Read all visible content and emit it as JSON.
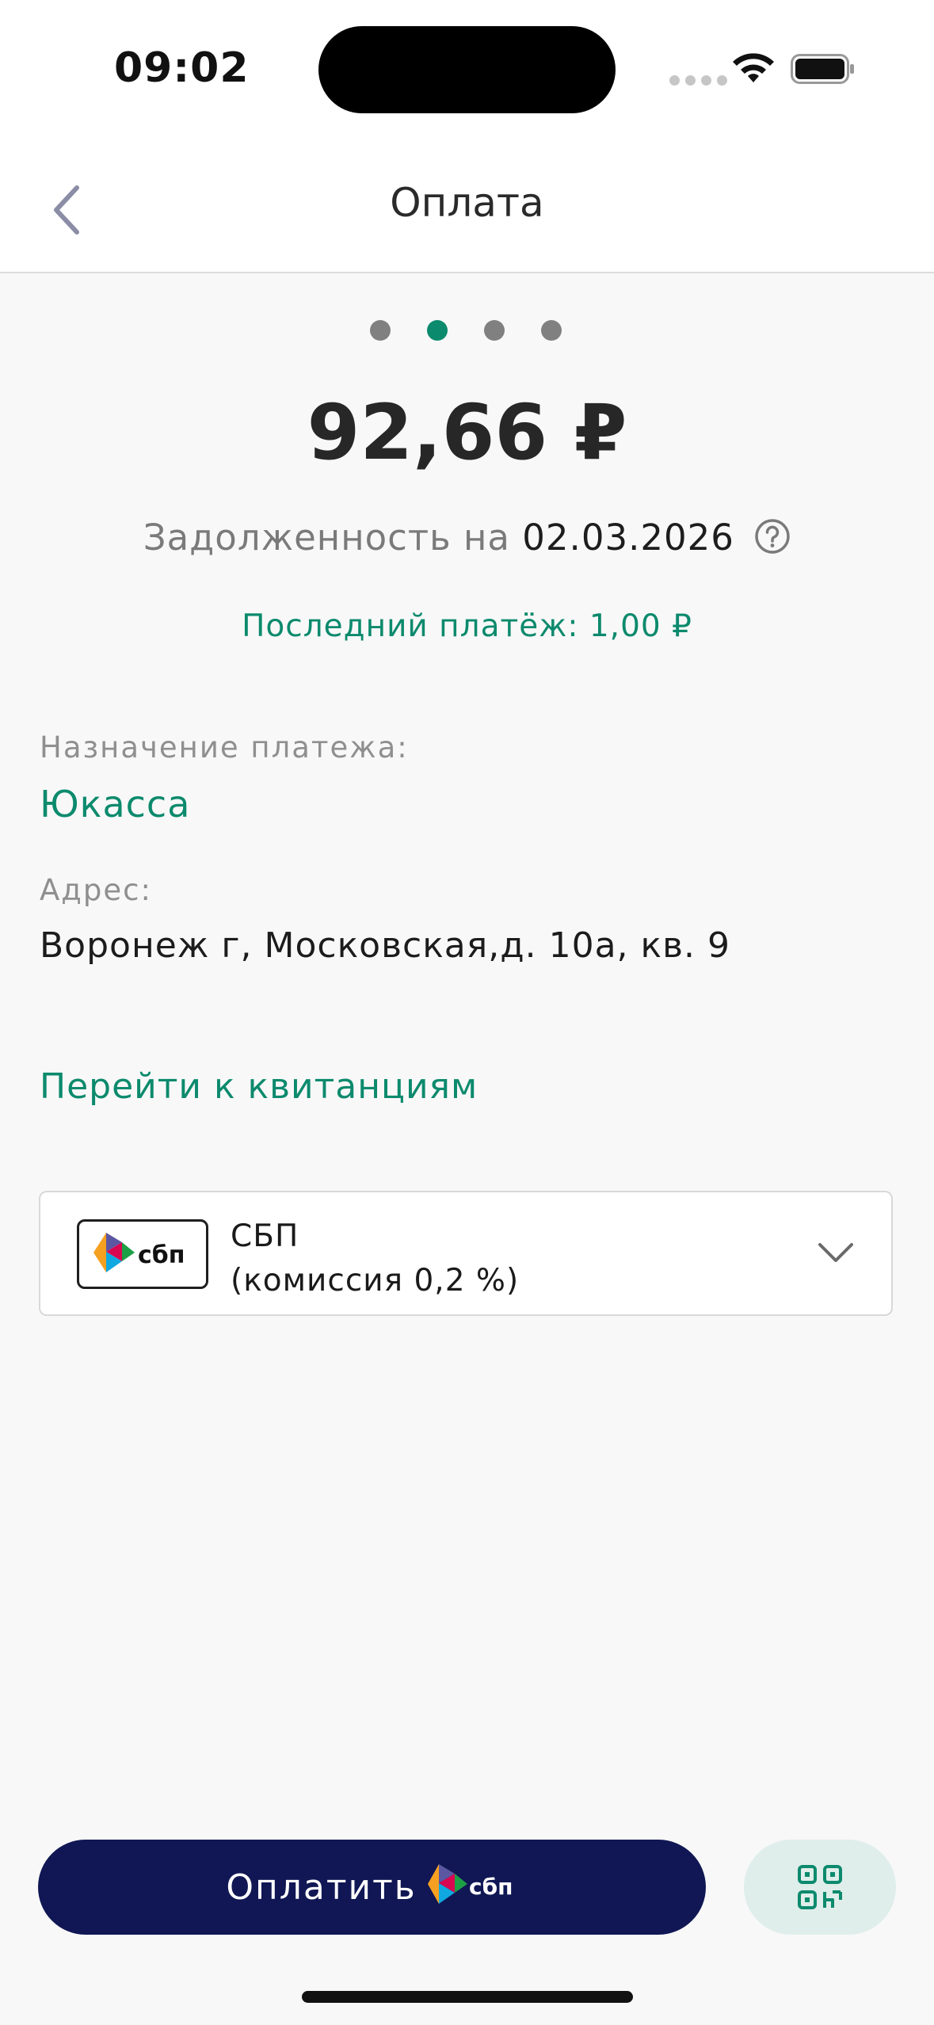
{
  "status_bar": {
    "time": "09:02"
  },
  "header": {
    "title": "Оплата",
    "back_icon": "chevron-left-icon"
  },
  "pager": {
    "count": 4,
    "active_index": 1
  },
  "payment": {
    "amount": "92,66 ₽",
    "debt_prefix": "Задолженность на",
    "debt_date": "02.03.2026",
    "help_icon": "question-circle-icon",
    "last_payment": "Последний платёж: 1,00 ₽"
  },
  "details": {
    "purpose_label": "Назначение платежа:",
    "purpose_value": "Юкасса",
    "address_label": "Адрес:",
    "address_value": "Воронеж г, Московская,д. 10а, кв. 9"
  },
  "links": {
    "receipts": "Перейти к квитанциям"
  },
  "payment_method": {
    "logo_text": "сбп",
    "name": "СБП",
    "commission": "(комиссия 0,2 %)",
    "chevron_icon": "chevron-down-icon"
  },
  "actions": {
    "pay_label": "Оплатить",
    "pay_logo_text": "сбп",
    "qr_icon": "qr-code-icon"
  },
  "colors": {
    "accent": "#0c8a6d",
    "pay_button": "#101754",
    "qr_button": "#dfeeea",
    "background": "#f8f8f8"
  }
}
